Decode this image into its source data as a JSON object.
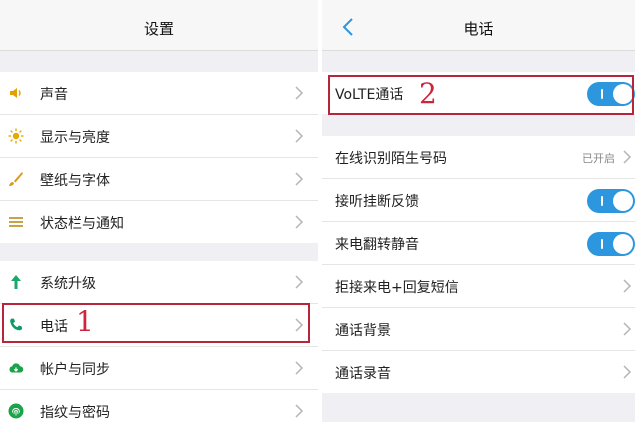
{
  "left": {
    "title": "设置",
    "group1": [
      {
        "label": "声音",
        "icon": "speaker-icon"
      },
      {
        "label": "显示与亮度",
        "icon": "brightness-icon"
      },
      {
        "label": "壁纸与字体",
        "icon": "brush-icon"
      },
      {
        "label": "状态栏与通知",
        "icon": "list-icon"
      }
    ],
    "group2": [
      {
        "label": "系统升级",
        "icon": "arrow-up-icon"
      },
      {
        "label": "电话",
        "icon": "phone-icon"
      },
      {
        "label": "帐户与同步",
        "icon": "cloud-icon"
      },
      {
        "label": "指纹与密码",
        "icon": "fingerprint-icon"
      }
    ],
    "annotation": "1"
  },
  "right": {
    "title": "电话",
    "volte": {
      "label": "VoLTE通话",
      "on": true
    },
    "annotation": "2",
    "items": [
      {
        "label": "在线识别陌生号码",
        "value": "已开启"
      },
      {
        "label": "接听挂断反馈",
        "on": true
      },
      {
        "label": "来电翻转静音",
        "on": true
      },
      {
        "label": "拒接来电+回复短信"
      },
      {
        "label": "通话背景"
      },
      {
        "label": "通话录音"
      }
    ]
  },
  "colors": {
    "toggle_on": "#2c97de",
    "annotation_red": "#d0243a",
    "highlight_border": "#b8243a",
    "speaker_icon": "#e2a100",
    "brightness_icon": "#e8a800",
    "brush_icon": "#d79a20",
    "list_icon": "#c9a24a",
    "arrow_up_icon": "#18a86b",
    "phone_icon": "#0e9a6a",
    "cloud_icon": "#1aa34a",
    "fingerprint_icon": "#1aa34a"
  }
}
